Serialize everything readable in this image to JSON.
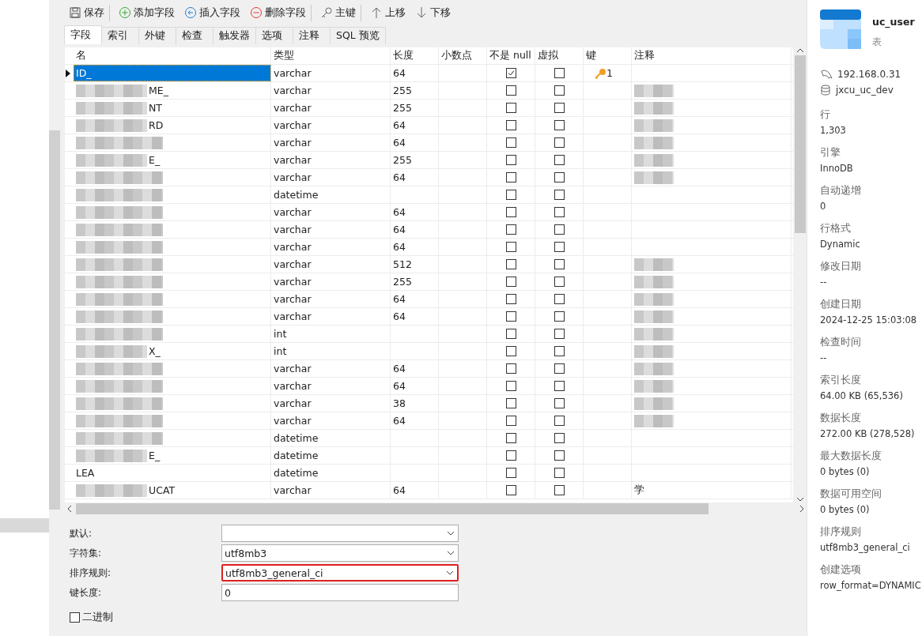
{
  "toolbar": [
    {
      "kind": "save",
      "label": "保存",
      "group_end": true
    },
    {
      "kind": "add",
      "label": "添加字段",
      "group_end": false
    },
    {
      "kind": "insert",
      "label": "插入字段",
      "group_end": false
    },
    {
      "kind": "delete",
      "label": "删除字段",
      "group_end": true
    },
    {
      "kind": "key",
      "label": "主键",
      "group_end": true
    },
    {
      "kind": "up",
      "label": "上移",
      "group_end": false
    },
    {
      "kind": "down",
      "label": "下移",
      "group_end": false
    }
  ],
  "tabs": [
    {
      "label": "字段",
      "selected": true
    },
    {
      "label": "索引",
      "selected": false
    },
    {
      "label": "外键",
      "selected": false
    },
    {
      "label": "检查",
      "selected": false
    },
    {
      "label": "触发器",
      "selected": false
    },
    {
      "label": "选项",
      "selected": false
    },
    {
      "label": "注释",
      "selected": false
    },
    {
      "label": "SQL 预览",
      "selected": false
    }
  ],
  "columns": [
    "名",
    "类型",
    "长度",
    "小数点",
    "不是 null",
    "虚拟",
    "键",
    "注释"
  ],
  "rows": [
    {
      "name": "ID_",
      "name_redacted": false,
      "type": "varchar",
      "length": "64",
      "not_null": true,
      "virtual": false,
      "key": "1",
      "comment_redacted": false,
      "selected": true
    },
    {
      "name": "ME_",
      "name_redacted": true,
      "type": "varchar",
      "length": "255",
      "not_null": false,
      "virtual": false,
      "comment_redacted": true,
      "selected": false
    },
    {
      "name": "NT",
      "name_redacted": true,
      "type": "varchar",
      "length": "255",
      "not_null": false,
      "virtual": false,
      "comment_redacted": true,
      "selected": false
    },
    {
      "name": "RD",
      "name_redacted": true,
      "type": "varchar",
      "length": "64",
      "not_null": false,
      "virtual": false,
      "comment_redacted": true,
      "selected": false
    },
    {
      "name_redacted": true,
      "type": "varchar",
      "length": "64",
      "not_null": false,
      "virtual": false,
      "comment_redacted": true,
      "selected": false
    },
    {
      "name": "E_",
      "name_redacted": true,
      "type": "varchar",
      "length": "255",
      "not_null": false,
      "virtual": false,
      "comment_redacted": true,
      "selected": false
    },
    {
      "name_redacted": true,
      "type": "varchar",
      "length": "64",
      "not_null": false,
      "virtual": false,
      "comment_redacted": true,
      "selected": false
    },
    {
      "name_redacted": true,
      "type": "datetime",
      "not_null": false,
      "virtual": false,
      "comment_redacted": false,
      "selected": false
    },
    {
      "name_redacted": true,
      "type": "varchar",
      "length": "64",
      "not_null": false,
      "virtual": false,
      "comment_redacted": false,
      "selected": false
    },
    {
      "name_redacted": true,
      "type": "varchar",
      "length": "64",
      "not_null": false,
      "virtual": false,
      "comment_redacted": false,
      "selected": false
    },
    {
      "name_redacted": true,
      "type": "varchar",
      "length": "64",
      "not_null": false,
      "virtual": false,
      "comment_redacted": false,
      "selected": false
    },
    {
      "name_redacted": true,
      "type": "varchar",
      "length": "512",
      "not_null": false,
      "virtual": false,
      "comment_redacted": true,
      "selected": false
    },
    {
      "name_redacted": true,
      "type": "varchar",
      "length": "255",
      "not_null": false,
      "virtual": false,
      "comment_redacted": true,
      "selected": false
    },
    {
      "name_redacted": true,
      "type": "varchar",
      "length": "64",
      "not_null": false,
      "virtual": false,
      "comment_redacted": true,
      "selected": false
    },
    {
      "name_redacted": true,
      "type": "varchar",
      "length": "64",
      "not_null": false,
      "virtual": false,
      "comment_redacted": true,
      "selected": false
    },
    {
      "name_redacted": true,
      "type": "int",
      "not_null": false,
      "virtual": false,
      "comment_redacted": true,
      "selected": false
    },
    {
      "name": "X_",
      "name_redacted": true,
      "type": "int",
      "not_null": false,
      "virtual": false,
      "comment_redacted": true,
      "selected": false
    },
    {
      "name_redacted": true,
      "type": "varchar",
      "length": "64",
      "not_null": false,
      "virtual": false,
      "comment_redacted": true,
      "selected": false
    },
    {
      "name_redacted": true,
      "type": "varchar",
      "length": "64",
      "not_null": false,
      "virtual": false,
      "comment_redacted": true,
      "selected": false
    },
    {
      "name_redacted": true,
      "type": "varchar",
      "length": "38",
      "not_null": false,
      "virtual": false,
      "comment_redacted": true,
      "selected": false
    },
    {
      "name_redacted": true,
      "type": "varchar",
      "length": "64",
      "not_null": false,
      "virtual": false,
      "comment_redacted": true,
      "selected": false
    },
    {
      "name_redacted": true,
      "type": "datetime",
      "not_null": false,
      "virtual": false,
      "comment_redacted": false,
      "selected": false
    },
    {
      "name": "E_",
      "name_redacted": true,
      "type": "datetime",
      "not_null": false,
      "virtual": false,
      "comment_redacted": false,
      "selected": false
    },
    {
      "name": "LEA",
      "name_redacted": false,
      "type": "datetime",
      "not_null": false,
      "virtual": false,
      "comment_redacted": false,
      "selected": false
    },
    {
      "name": "UCAT",
      "name_redacted": true,
      "type": "varchar",
      "length": "64",
      "not_null": false,
      "virtual": false,
      "comment": "学",
      "comment_redacted": false,
      "selected": false
    }
  ],
  "properties": [
    {
      "label": "默认:",
      "kind": "select",
      "highlighted": false
    },
    {
      "label": "字符集:",
      "kind": "select",
      "value": "utf8mb3",
      "highlighted": false
    },
    {
      "label": "排序规则:",
      "kind": "select",
      "value": "utf8mb3_general_ci",
      "highlighted": true
    },
    {
      "label": "键长度:",
      "kind": "text",
      "value": "0",
      "highlighted": false
    }
  ],
  "binary": {
    "label": "二进制",
    "checked": false
  },
  "info": {
    "title": "uc_user",
    "subtitle": "表",
    "host": "192.168.0.31",
    "database": "jxcu_uc_dev",
    "fields": [
      {
        "label": "行",
        "value": "1,303"
      },
      {
        "label": "引擎",
        "value": "InnoDB"
      },
      {
        "label": "自动递增",
        "value": "0"
      },
      {
        "label": "行格式",
        "value": "Dynamic"
      },
      {
        "label": "修改日期",
        "value": "--"
      },
      {
        "label": "创建日期",
        "value": "2024-12-25 15:03:08"
      },
      {
        "label": "检查时间",
        "value": "--"
      },
      {
        "label": "索引长度",
        "value": "64.00 KB (65,536)"
      },
      {
        "label": "数据长度",
        "value": "272.00 KB (278,528)"
      },
      {
        "label": "最大数据长度",
        "value": "0 bytes (0)"
      },
      {
        "label": "数据可用空间",
        "value": "0 bytes (0)"
      },
      {
        "label": "排序规则",
        "value": "utf8mb3_general_ci"
      },
      {
        "label": "创建选项",
        "value": "row_format=DYNAMIC"
      }
    ]
  }
}
